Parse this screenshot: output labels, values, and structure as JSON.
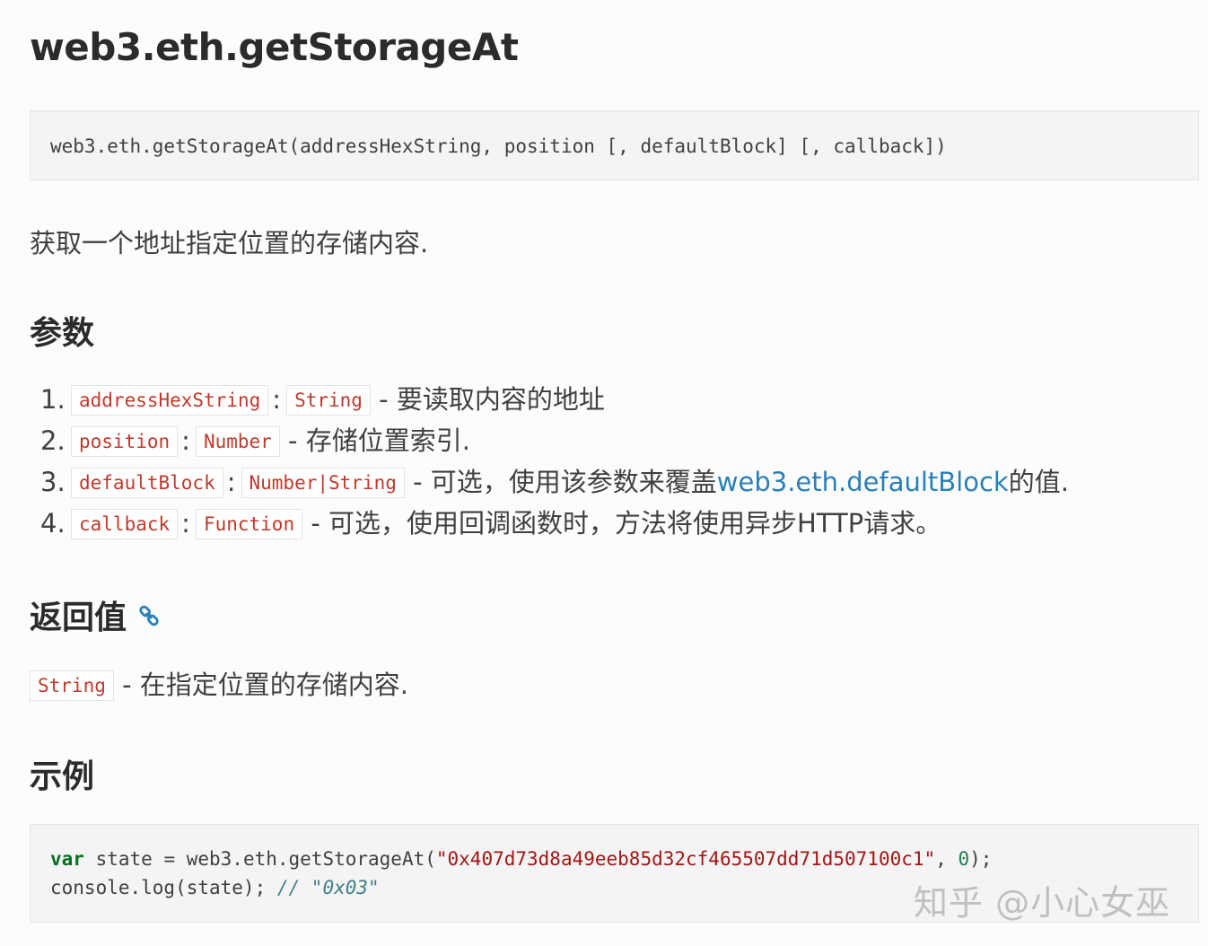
{
  "title": "web3.eth.getStorageAt",
  "signature": "web3.eth.getStorageAt(addressHexString, position [, defaultBlock] [, callback])",
  "description": "获取一个地址指定位置的存储内容.",
  "params_heading": "参数",
  "params": [
    {
      "num": "1.",
      "name": "addressHexString",
      "type": "String",
      "desc": "- 要读取内容的地址",
      "link": "",
      "desc_after": ""
    },
    {
      "num": "2.",
      "name": "position",
      "type": "Number",
      "desc": "- 存储位置索引.",
      "link": "",
      "desc_after": ""
    },
    {
      "num": "3.",
      "name": "defaultBlock",
      "type": "Number|String",
      "desc": "- 可选，使用该参数来覆盖",
      "link": "web3.eth.defaultBlock",
      "desc_after": "的值."
    },
    {
      "num": "4.",
      "name": "callback",
      "type": "Function",
      "desc": "- 可选，使用回调函数时，方法将使用异步HTTP请求。",
      "link": "",
      "desc_after": ""
    }
  ],
  "return_heading": "返回值",
  "return_type": "String",
  "return_desc": "- 在指定位置的存储内容.",
  "example_heading": "示例",
  "example": {
    "kw": "var",
    "l1_a": " state = web3.eth.getStorageAt(",
    "l1_str": "\"0x407d73d8a49eeb85d32cf465507dd71d507100c1\"",
    "l1_b": ", ",
    "l1_num": "0",
    "l1_c": ");",
    "l2_a": "console.log(state); ",
    "l2_cmt": "// \"0x03\""
  },
  "watermark": "知乎 @小心女巫",
  "colors": {
    "link": "#2980b9",
    "literal": "#c0392b",
    "code_bg": "#f4f4f4"
  }
}
